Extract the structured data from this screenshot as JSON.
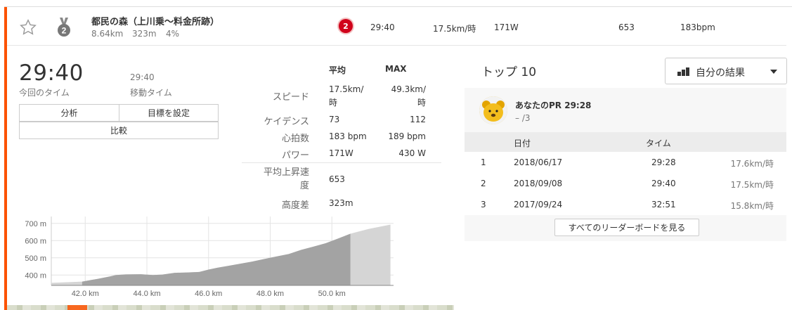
{
  "segment": {
    "name": "都民の森（上川乗〜料金所跡）",
    "distance": "8.64km",
    "elevation": "323m",
    "grade": "4%",
    "medal_rank": "2",
    "rank_badge": "2",
    "time": "29:40",
    "speed": "17.5km/時",
    "power": "171W",
    "vam": "653",
    "heartrate": "183bpm"
  },
  "summary": {
    "elapsed_time": "29:40",
    "elapsed_label": "今回のタイム",
    "moving_time": "29:40",
    "moving_label": "移動タイム",
    "analyze_button": "分析",
    "goal_button": "目標を設定",
    "compare_button": "比較"
  },
  "stats": {
    "avg_header": "平均",
    "max_header": "MAX",
    "rows": [
      {
        "label": "スピード",
        "avg": "17.5km/\n時",
        "max": "49.3km/\n時"
      },
      {
        "label": "ケイデンス",
        "avg": "73",
        "max": "112"
      },
      {
        "label": "心拍数",
        "avg": "183 bpm",
        "max": "189 bpm"
      },
      {
        "label": "パワー",
        "avg": "171W",
        "max": "430 W"
      }
    ],
    "vam_label": "平均上昇速\n度",
    "vam_value": "653",
    "elev_label": "高度差",
    "elev_value": "323m"
  },
  "chart_data": {
    "type": "area",
    "x_ticks": [
      "42.0 km",
      "44.0 km",
      "46.0 km",
      "48.0 km",
      "50.0 km"
    ],
    "y_ticks": [
      "700 m",
      "600 m",
      "500 m",
      "400 m"
    ],
    "xlim": [
      40.9,
      52.0
    ],
    "ylim": [
      340,
      740
    ],
    "segment_range": [
      41.9,
      50.6
    ],
    "x": [
      40.9,
      41.9,
      42.4,
      42.8,
      43.0,
      43.3,
      43.8,
      44.2,
      44.5,
      44.9,
      45.3,
      45.7,
      46.0,
      46.3,
      46.6,
      47.0,
      47.4,
      47.8,
      48.2,
      48.6,
      49.0,
      49.4,
      49.8,
      50.2,
      50.6,
      51.2,
      51.9
    ],
    "y": [
      355,
      362,
      378,
      392,
      400,
      404,
      405,
      400,
      403,
      413,
      415,
      418,
      432,
      443,
      452,
      465,
      478,
      493,
      508,
      522,
      546,
      565,
      585,
      612,
      640,
      668,
      693
    ]
  },
  "leaderboard": {
    "title": "トップ 10",
    "filter_label": "自分の結果",
    "pr_label": "あなたのPR 29:28",
    "pr_rank": "– /3",
    "col_date": "日付",
    "col_time": "タイム",
    "rows": [
      {
        "rank": "1",
        "date": "2018/06/17",
        "time": "29:28",
        "speed": "17.6km/時"
      },
      {
        "rank": "2",
        "date": "2018/09/08",
        "time": "29:40",
        "speed": "17.5km/時"
      },
      {
        "rank": "3",
        "date": "2017/09/24",
        "time": "32:51",
        "speed": "15.8km/時"
      }
    ],
    "full_board_button": "すべてのリーダーボードを見る"
  },
  "colors": {
    "accent": "#fc5200",
    "rank_badge": "#d0021b",
    "area_light": "#d5d5d5",
    "area_dark": "#a3a3a3"
  }
}
